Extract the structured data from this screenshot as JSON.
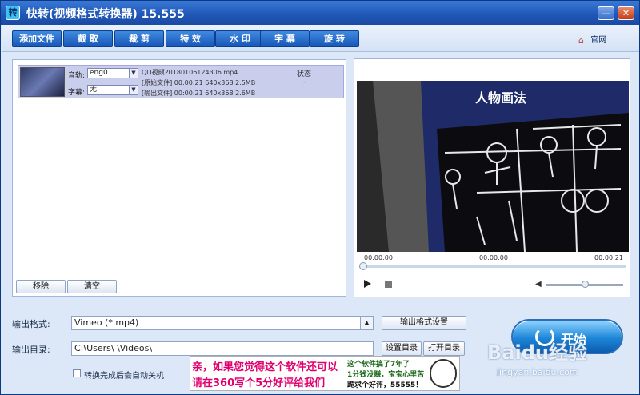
{
  "window": {
    "title": "快转(视频格式转换器) 15.555",
    "app_icon_glyph": "转",
    "min_label": "—",
    "close_label": "✕"
  },
  "toolbar": {
    "buttons": [
      "添加文件",
      "截 取",
      "裁 剪",
      "特 效",
      "水 印",
      "字 幕",
      "旋 转"
    ],
    "home_label": "官网"
  },
  "file_list": {
    "item": {
      "audio_label": "音轨:",
      "audio_value": "eng0",
      "subtitle_label": "字幕:",
      "subtitle_value": "无",
      "filename": "QQ视频20180106124306.mp4",
      "status_header": "状态",
      "status_value": "-",
      "source_line": "[原始文件]  00:00:21  640x368  2.5MB",
      "output_line": "[输出文件]  00:00:21  640x368  2.6MB"
    },
    "remove_label": "移除",
    "clear_label": "清空"
  },
  "preview": {
    "time_start": "00:00:00",
    "time_current": "00:00:00",
    "time_end": "00:00:21",
    "video_text": "人物画法",
    "progress": 0.0,
    "volume": 0.5
  },
  "output": {
    "format_label": "输出格式:",
    "format_value": "Vimeo (*.mp4)",
    "format_settings_label": "输出格式设置",
    "dir_label": "输出目录:",
    "dir_value": "C:\\Users\\        \\Videos\\",
    "set_dir_label": "设置目录",
    "open_dir_label": "打开目录",
    "shutdown_label": "转换完成后会自动关机"
  },
  "start": {
    "label": "开始"
  },
  "banner": {
    "line1": "亲，如果您觉得这个软件还可以",
    "line2": "请在360写个5分好评给我们",
    "line3": "这个软件搞了7年了",
    "line4": "1分钱没赚，宝宝心里苦",
    "line5": "跪求个好评，55555！"
  },
  "watermark": {
    "main": "Baidu经验",
    "sub": "jingyan.baidu.com"
  }
}
